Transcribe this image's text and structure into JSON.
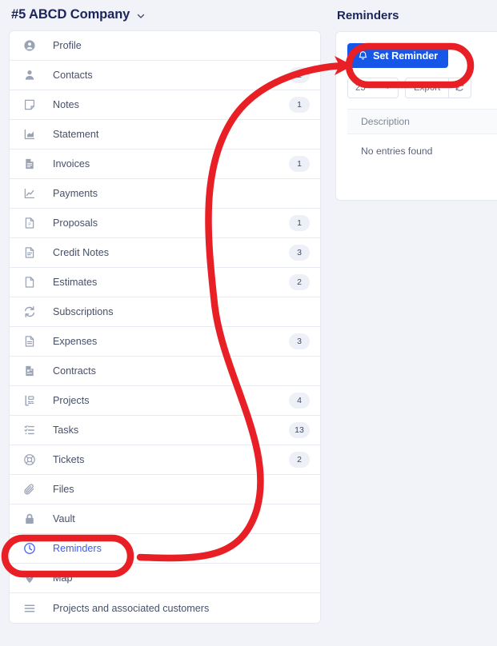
{
  "company": {
    "title": "#5 ABCD Company",
    "caret_icon": "chevron-down-icon"
  },
  "nav": {
    "items": [
      {
        "label": "Profile",
        "icon": "user-circle-icon",
        "badge": "",
        "active": false
      },
      {
        "label": "Contacts",
        "icon": "user-icon",
        "badge": "2",
        "active": false
      },
      {
        "label": "Notes",
        "icon": "note-icon",
        "badge": "1",
        "active": false
      },
      {
        "label": "Statement",
        "icon": "chart-bar-icon",
        "badge": "",
        "active": false
      },
      {
        "label": "Invoices",
        "icon": "invoice-icon",
        "badge": "1",
        "active": false
      },
      {
        "label": "Payments",
        "icon": "line-chart-icon",
        "badge": "",
        "active": false
      },
      {
        "label": "Proposals",
        "icon": "proposal-icon",
        "badge": "1",
        "active": false
      },
      {
        "label": "Credit Notes",
        "icon": "credit-note-icon",
        "badge": "3",
        "active": false
      },
      {
        "label": "Estimates",
        "icon": "file-icon",
        "badge": "2",
        "active": false
      },
      {
        "label": "Subscriptions",
        "icon": "recurring-icon",
        "badge": "",
        "active": false
      },
      {
        "label": "Expenses",
        "icon": "expense-icon",
        "badge": "3",
        "active": false
      },
      {
        "label": "Contracts",
        "icon": "contract-icon",
        "badge": "",
        "active": false
      },
      {
        "label": "Projects",
        "icon": "project-icon",
        "badge": "4",
        "active": false
      },
      {
        "label": "Tasks",
        "icon": "task-list-icon",
        "badge": "13",
        "active": false
      },
      {
        "label": "Tickets",
        "icon": "lifebuoy-icon",
        "badge": "2",
        "active": false
      },
      {
        "label": "Files",
        "icon": "paperclip-icon",
        "badge": "",
        "active": false
      },
      {
        "label": "Vault",
        "icon": "lock-icon",
        "badge": "",
        "active": false
      },
      {
        "label": "Reminders",
        "icon": "clock-icon",
        "badge": "",
        "active": true
      },
      {
        "label": "Map",
        "icon": "map-pin-icon",
        "badge": "",
        "active": false
      },
      {
        "label": "Projects and associated customers",
        "icon": "menu-lines-icon",
        "badge": "",
        "active": false
      }
    ]
  },
  "reminders_panel": {
    "title": "Reminders",
    "set_reminder_label": "Set Reminder",
    "bell_icon": "bell-icon",
    "page_size_value": "25",
    "page_size_options": [
      "25"
    ],
    "export_label": "Export",
    "refresh_icon": "refresh-icon",
    "table": {
      "columns": [
        "Description"
      ],
      "empty_text": "No entries found",
      "rows": []
    }
  },
  "annotations": {
    "highlight_color": "#e81f25",
    "arrow_label": "curved-arrow-reminders-to-set-reminder",
    "ellipse_target_nav": "Reminders",
    "ellipse_target_button": "Set Reminder"
  }
}
